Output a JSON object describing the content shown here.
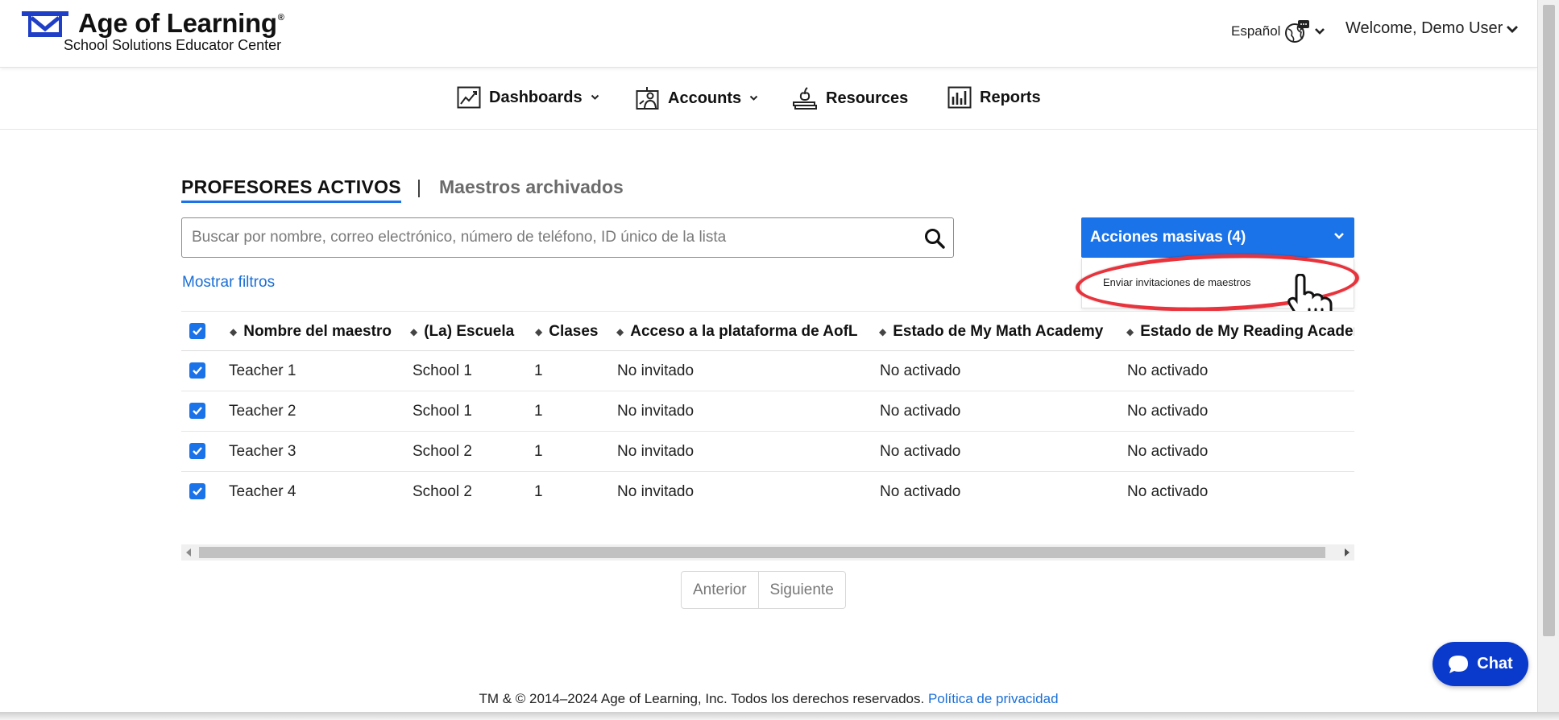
{
  "header": {
    "brand_name": "Age of Learning",
    "brand_mark": "®",
    "brand_sub": "School Solutions Educator Center",
    "language_label": "Español",
    "welcome": "Welcome, Demo User"
  },
  "nav": {
    "items": [
      {
        "label": "Dashboards",
        "icon": "chart-line-icon",
        "has_dropdown": true
      },
      {
        "label": "Accounts",
        "icon": "teacher-board-icon",
        "has_dropdown": true
      },
      {
        "label": "Resources",
        "icon": "books-apple-icon",
        "has_dropdown": false
      },
      {
        "label": "Reports",
        "icon": "bar-chart-icon",
        "has_dropdown": false
      }
    ]
  },
  "tabs": {
    "active": "PROFESORES ACTIVOS",
    "separator": "|",
    "inactive": "Maestros archivados"
  },
  "search": {
    "placeholder": "Buscar por nombre, correo electrónico, número de teléfono, ID único de la lista",
    "value": ""
  },
  "filters_link": "Mostrar filtros",
  "bulk_actions": {
    "label": "Acciones masivas (4)",
    "menu_items": [
      "Enviar invitaciones de maestros"
    ]
  },
  "table": {
    "columns": [
      "Nombre del maestro",
      "(La) Escuela",
      "Clases",
      "Acceso a la plataforma de AofL",
      "Estado de My Math Academy",
      "Estado de My Reading Academy"
    ],
    "rows": [
      {
        "checked": true,
        "name": "Teacher 1",
        "school": "School 1",
        "classes": "1",
        "access": "No invitado",
        "math": "No activado",
        "reading": "No activado"
      },
      {
        "checked": true,
        "name": "Teacher 2",
        "school": "School 1",
        "classes": "1",
        "access": "No invitado",
        "math": "No activado",
        "reading": "No activado"
      },
      {
        "checked": true,
        "name": "Teacher 3",
        "school": "School 2",
        "classes": "1",
        "access": "No invitado",
        "math": "No activado",
        "reading": "No activado"
      },
      {
        "checked": true,
        "name": "Teacher 4",
        "school": "School 2",
        "classes": "1",
        "access": "No invitado",
        "math": "No activado",
        "reading": "No activado"
      }
    ]
  },
  "pagination": {
    "prev": "Anterior",
    "next": "Siguiente"
  },
  "chat": {
    "label": "Chat"
  },
  "footer": {
    "text": "TM & © 2014–2024 Age of Learning, Inc. Todos los derechos reservados.",
    "link": "Política de privacidad"
  },
  "colors": {
    "accent": "#1a73e8",
    "highlight": "#e8333c",
    "chat": "#0a3acb",
    "link": "#1a6fd6"
  }
}
